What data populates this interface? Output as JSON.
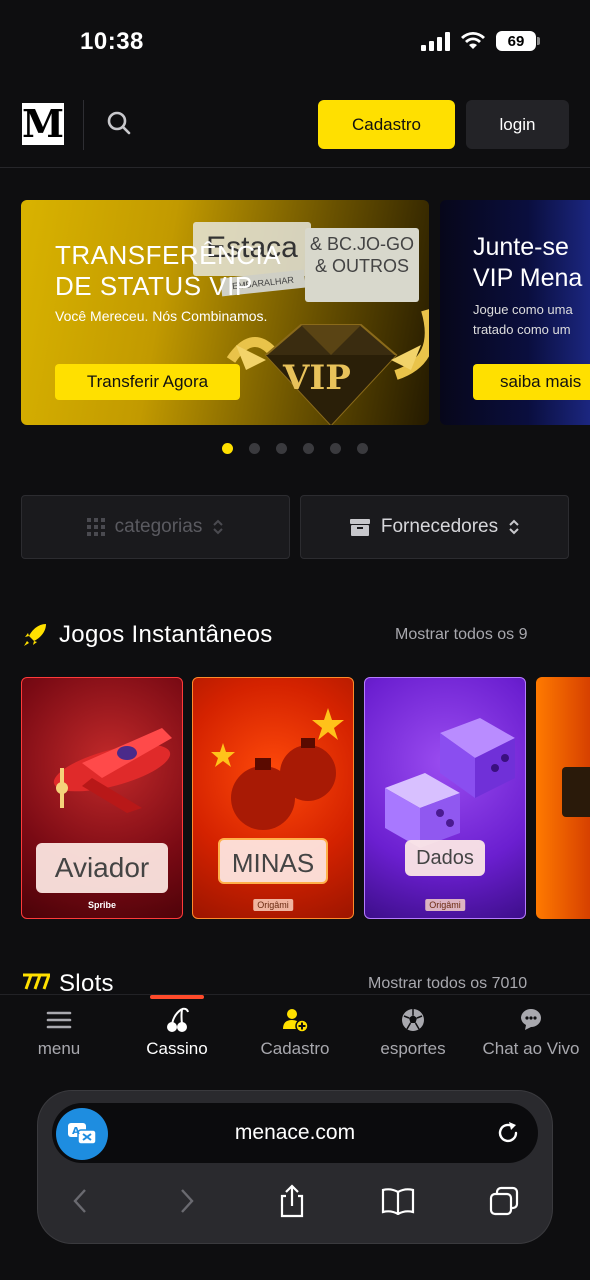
{
  "status": {
    "time": "10:38",
    "battery": "69"
  },
  "header": {
    "logo": "M",
    "cadastro_label": "Cadastro",
    "login_label": "login"
  },
  "banners": [
    {
      "title": "TRANSFERÊNCIA DE STATUS VIP",
      "subtitle": "Você Mereceu. Nós Combinamos.",
      "button": "Transferir Agora",
      "tag_estaca": "Estaca",
      "tag_embaralhar": "EMBARALHAR",
      "tag_bcjogo": "& BC.JO-GO & OUTROS",
      "vip_text": "VIP"
    },
    {
      "title": "Junte-se VIP Mena",
      "subtitle": "Jogue como uma tratado como um",
      "button": "saiba mais"
    }
  ],
  "carousel": {
    "count": 6,
    "active": 0
  },
  "filters": {
    "categorias": "categorias",
    "fornecedores": "Fornecedores"
  },
  "instant_games": {
    "title": "Jogos Instantâneos",
    "show_all": "Mostrar todos os 9",
    "games": [
      {
        "name": "Aviador",
        "provider": "Spribe"
      },
      {
        "name": "MINAS",
        "provider": "Origâmi"
      },
      {
        "name": "Dados",
        "provider": "Origâmi"
      }
    ]
  },
  "slots": {
    "title": "Slots",
    "show_all": "Mostrar todos os 7010"
  },
  "bottom_nav": [
    {
      "label": "menu",
      "icon": "menu-icon"
    },
    {
      "label": "Cassino",
      "icon": "cherries-icon",
      "active": true
    },
    {
      "label": "Cadastro",
      "icon": "add-user-icon"
    },
    {
      "label": "esportes",
      "icon": "soccer-ball-icon"
    },
    {
      "label": "Chat ao Vivo",
      "icon": "chat-icon"
    }
  ],
  "browser": {
    "url": "menace.com"
  },
  "colors": {
    "accent": "#ffe000",
    "background": "#0e0e10",
    "nav_indicator": "#ff4b2b"
  }
}
